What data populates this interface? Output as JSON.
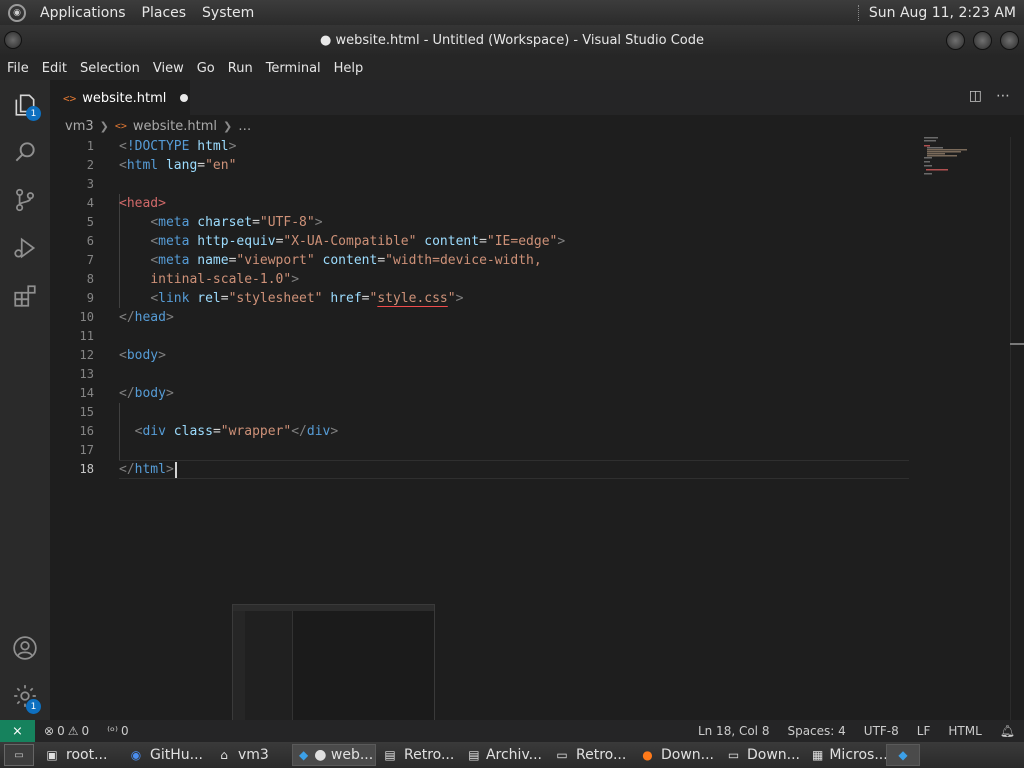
{
  "panel": {
    "menus": [
      "Applications",
      "Places",
      "System"
    ],
    "clock": "Sun Aug 11,  2:23 AM"
  },
  "window": {
    "title": "● website.html - Untitled (Workspace) - Visual Studio Code"
  },
  "menubar": [
    "File",
    "Edit",
    "Selection",
    "View",
    "Go",
    "Run",
    "Terminal",
    "Help"
  ],
  "activity": {
    "explorer_badge": "1",
    "settings_badge": "1"
  },
  "tab": {
    "label": "website.html",
    "icon": "<>"
  },
  "breadcrumb": {
    "folder": "vm3",
    "file": "website.html",
    "more": "…"
  },
  "editor": {
    "line_numbers": [
      "1",
      "2",
      "3",
      "4",
      "5",
      "6",
      "7",
      "8",
      "9",
      "10",
      "11",
      "12",
      "13",
      "14",
      "15",
      "16",
      "17",
      "18"
    ],
    "current_line": "18"
  },
  "statusbar": {
    "errors": "0",
    "warnings": "0",
    "ports": "0",
    "position": "Ln 18, Col 8",
    "spaces": "Spaces: 4",
    "encoding": "UTF-8",
    "eol": "LF",
    "language": "HTML"
  },
  "taskbar": {
    "items": [
      {
        "label": "root...",
        "icon": "terminal-icon"
      },
      {
        "label": "GitHu...",
        "icon": "chrome-icon"
      },
      {
        "label": "vm3",
        "icon": "home-folder-icon"
      },
      {
        "label": "● web...",
        "icon": "vscode-icon"
      },
      {
        "label": "Retro...",
        "icon": "app-icon"
      },
      {
        "label": "Archiv...",
        "icon": "app-icon"
      },
      {
        "label": "Retro...",
        "icon": "folder-icon"
      },
      {
        "label": "Down...",
        "icon": "firefox-icon"
      },
      {
        "label": "Down...",
        "icon": "folder-icon"
      },
      {
        "label": "Micros...",
        "icon": "app-icon"
      }
    ]
  }
}
